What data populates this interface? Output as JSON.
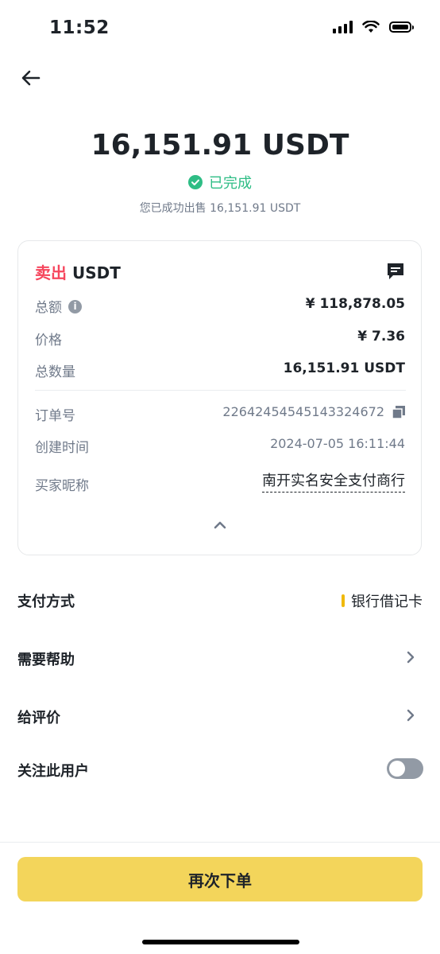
{
  "status_bar": {
    "time": "11:52"
  },
  "order": {
    "amount": "16,151.91 USDT",
    "status": "已完成",
    "status_color": "#2ebd85",
    "summary": "您已成功出售 16,151.91 USDT"
  },
  "card": {
    "side": "卖出",
    "asset": "USDT",
    "side_color": "#f6465d",
    "rows": [
      {
        "label": "总额",
        "value": "¥ 118,878.05"
      },
      {
        "label": "价格",
        "value": "¥ 7.36"
      },
      {
        "label": "总数量",
        "value": "16,151.91 USDT"
      }
    ],
    "details": [
      {
        "label": "订单号",
        "value": "22642454545143324672"
      },
      {
        "label": "创建时间",
        "value": "2024-07-05 16:11:44"
      },
      {
        "label": "买家昵称",
        "value": "南开实名安全支付商行"
      }
    ]
  },
  "menu": {
    "payment_label": "支付方式",
    "payment_value": "银行借记卡",
    "help_label": "需要帮助",
    "review_label": "给评价",
    "follow_label": "关注此用户",
    "follow_on": false
  },
  "cta": {
    "label": "再次下单",
    "color": "#f3d55b"
  },
  "icons": [
    "back-arrow-icon",
    "check-circle-icon",
    "chat-icon",
    "info-icon",
    "copy-icon",
    "chevron-up-icon",
    "chevron-right-icon"
  ]
}
